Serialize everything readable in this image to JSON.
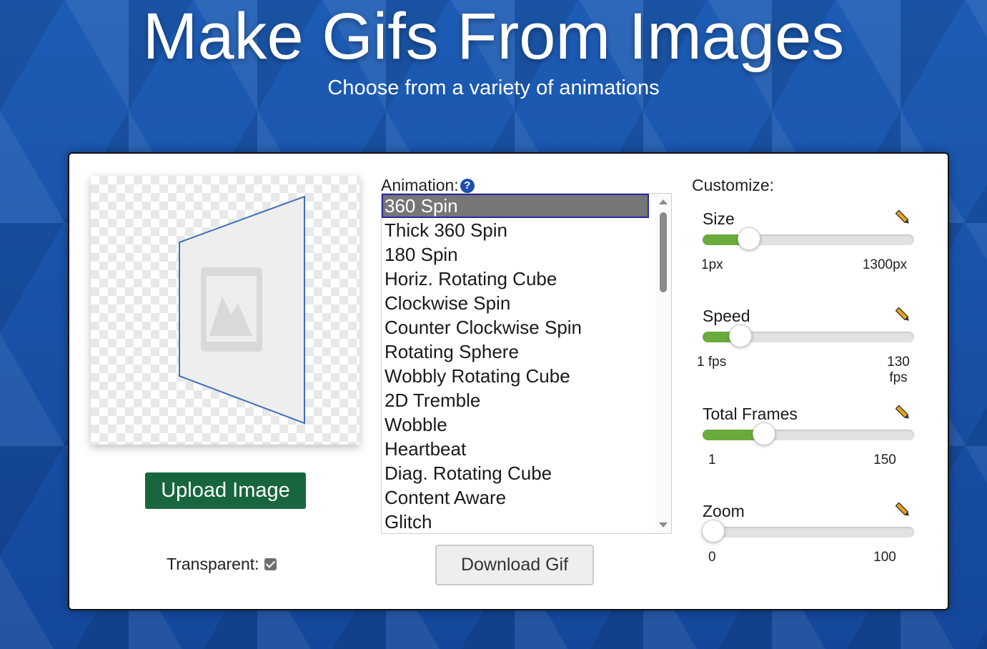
{
  "header": {
    "title": "Make Gifs From Images",
    "subtitle": "Choose from a variety of animations"
  },
  "left": {
    "upload_label": "Upload Image",
    "transparent_label": "Transparent:",
    "transparent_checked": true
  },
  "animation": {
    "label": "Animation:",
    "help_glyph": "?",
    "items": [
      "360 Spin",
      "Thick 360 Spin",
      "180 Spin",
      "Horiz. Rotating Cube",
      "Clockwise Spin",
      "Counter Clockwise Spin",
      "Rotating Sphere",
      "Wobbly Rotating Cube",
      "2D Tremble",
      "Wobble",
      "Heartbeat",
      "Diag. Rotating Cube",
      "Content Aware",
      "Glitch"
    ],
    "selected": "360 Spin",
    "download_label": "Download Gif"
  },
  "customize": {
    "title": "Customize:",
    "controls": [
      {
        "label": "Size",
        "min": "1px",
        "max": "1300px",
        "fraction": 0.22
      },
      {
        "label": "Speed",
        "min": "1 fps",
        "max": "130 fps",
        "fraction": 0.18
      },
      {
        "label": "Total Frames",
        "min": "1",
        "max": "150",
        "fraction": 0.29
      },
      {
        "label": "Zoom",
        "min": "0",
        "max": "100",
        "fraction": 0.05
      }
    ]
  },
  "colors": {
    "accent_green": "#18663d",
    "slider_fill": "#6aab3d",
    "background_blue": "#1a55a8",
    "pencil": "#e8a317"
  }
}
